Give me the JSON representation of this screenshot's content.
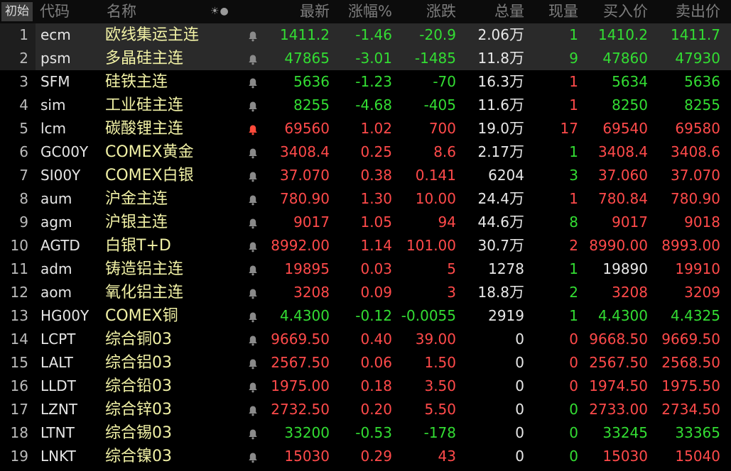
{
  "colors": {
    "up": "#ff4a4a",
    "down": "#33dd33",
    "neutral": "#e8e8e8",
    "name": "#f2f2a6",
    "bell_active": "#ff4a3a",
    "bell_default": "#8a8a8a"
  },
  "header": {
    "corner": "初始",
    "icons": "☀●",
    "columns": {
      "code": "代码",
      "name": "名称",
      "last": "最新",
      "pct": "涨幅%",
      "chg": "涨跌",
      "vol": "总量",
      "cur": "现量",
      "bid": "买入价",
      "ask": "卖出价"
    }
  },
  "rows": [
    {
      "idx": "1",
      "code": "ecm",
      "name": "欧线集运主连",
      "bell": "default",
      "last": "1411.2",
      "pct": "-1.46",
      "chg": "-20.9",
      "vol": "2.06",
      "unit": "万",
      "cur": "1",
      "bid": "1410.2",
      "ask": "1411.7",
      "trend": "down",
      "cur_trend": "down",
      "bid_trend": "down",
      "ask_trend": "down",
      "selected": true
    },
    {
      "idx": "2",
      "code": "psm",
      "name": "多晶硅主连",
      "bell": "default",
      "last": "47865",
      "pct": "-3.01",
      "chg": "-1485",
      "vol": "11.8",
      "unit": "万",
      "cur": "9",
      "bid": "47860",
      "ask": "47930",
      "trend": "down",
      "cur_trend": "down",
      "bid_trend": "down",
      "ask_trend": "down",
      "selected": true
    },
    {
      "idx": "3",
      "code": "SFM",
      "name": "硅铁主连",
      "bell": "default",
      "last": "5636",
      "pct": "-1.23",
      "chg": "-70",
      "vol": "16.3",
      "unit": "万",
      "cur": "1",
      "bid": "5634",
      "ask": "5636",
      "trend": "down",
      "cur_trend": "up",
      "bid_trend": "down",
      "ask_trend": "down"
    },
    {
      "idx": "4",
      "code": "sim",
      "name": "工业硅主连",
      "bell": "default",
      "last": "8255",
      "pct": "-4.68",
      "chg": "-405",
      "vol": "11.6",
      "unit": "万",
      "cur": "1",
      "bid": "8250",
      "ask": "8255",
      "trend": "down",
      "cur_trend": "up",
      "bid_trend": "down",
      "ask_trend": "down"
    },
    {
      "idx": "5",
      "code": "lcm",
      "name": "碳酸锂主连",
      "bell": "active",
      "last": "69560",
      "pct": "1.02",
      "chg": "700",
      "vol": "19.0",
      "unit": "万",
      "cur": "17",
      "bid": "69540",
      "ask": "69580",
      "trend": "up",
      "cur_trend": "up",
      "bid_trend": "up",
      "ask_trend": "up"
    },
    {
      "idx": "6",
      "code": "GC00Y",
      "name": "COMEX黄金",
      "bell": "default",
      "last": "3408.4",
      "pct": "0.25",
      "chg": "8.6",
      "vol": "2.17",
      "unit": "万",
      "cur": "1",
      "bid": "3408.4",
      "ask": "3408.6",
      "trend": "up",
      "cur_trend": "down",
      "bid_trend": "up",
      "ask_trend": "up"
    },
    {
      "idx": "7",
      "code": "SI00Y",
      "name": "COMEX白银",
      "bell": "default",
      "last": "37.070",
      "pct": "0.38",
      "chg": "0.141",
      "vol": "6204",
      "unit": "",
      "cur": "3",
      "bid": "37.060",
      "ask": "37.070",
      "trend": "up",
      "cur_trend": "down",
      "bid_trend": "up",
      "ask_trend": "up"
    },
    {
      "idx": "8",
      "code": "aum",
      "name": "沪金主连",
      "bell": "default",
      "last": "780.90",
      "pct": "1.30",
      "chg": "10.00",
      "vol": "24.4",
      "unit": "万",
      "cur": "1",
      "bid": "780.84",
      "ask": "780.90",
      "trend": "up",
      "cur_trend": "up",
      "bid_trend": "up",
      "ask_trend": "up"
    },
    {
      "idx": "9",
      "code": "agm",
      "name": "沪银主连",
      "bell": "default",
      "last": "9017",
      "pct": "1.05",
      "chg": "94",
      "vol": "44.6",
      "unit": "万",
      "cur": "8",
      "bid": "9017",
      "ask": "9018",
      "trend": "up",
      "cur_trend": "down",
      "bid_trend": "up",
      "ask_trend": "up"
    },
    {
      "idx": "10",
      "code": "AGTD",
      "name": "白银T+D",
      "bell": "default",
      "last": "8992.00",
      "pct": "1.14",
      "chg": "101.00",
      "vol": "30.7",
      "unit": "万",
      "cur": "2",
      "bid": "8990.00",
      "ask": "8993.00",
      "trend": "up",
      "cur_trend": "up",
      "bid_trend": "up",
      "ask_trend": "up"
    },
    {
      "idx": "11",
      "code": "adm",
      "name": "铸造铝主连",
      "bell": "default",
      "last": "19895",
      "pct": "0.03",
      "chg": "5",
      "vol": "1278",
      "unit": "",
      "cur": "1",
      "bid": "19890",
      "ask": "19910",
      "trend": "up",
      "cur_trend": "down",
      "bid_trend": "neutral",
      "ask_trend": "up"
    },
    {
      "idx": "12",
      "code": "aom",
      "name": "氧化铝主连",
      "bell": "default",
      "last": "3208",
      "pct": "0.09",
      "chg": "3",
      "vol": "18.8",
      "unit": "万",
      "cur": "2",
      "bid": "3208",
      "ask": "3209",
      "trend": "up",
      "cur_trend": "down",
      "bid_trend": "up",
      "ask_trend": "up"
    },
    {
      "idx": "13",
      "code": "HG00Y",
      "name": "COMEX铜",
      "bell": "default",
      "last": "4.4300",
      "pct": "-0.12",
      "chg": "-0.0055",
      "vol": "2919",
      "unit": "",
      "cur": "1",
      "bid": "4.4300",
      "ask": "4.4325",
      "trend": "down",
      "cur_trend": "down",
      "bid_trend": "down",
      "ask_trend": "down"
    },
    {
      "idx": "14",
      "code": "LCPT",
      "name": "综合铜03",
      "bell": "default",
      "last": "9669.50",
      "pct": "0.40",
      "chg": "39.00",
      "vol": "0",
      "unit": "",
      "cur": "0",
      "bid": "9668.50",
      "ask": "9669.50",
      "trend": "up",
      "cur_trend": "up",
      "bid_trend": "up",
      "ask_trend": "up"
    },
    {
      "idx": "15",
      "code": "LALT",
      "name": "综合铝03",
      "bell": "default",
      "last": "2567.50",
      "pct": "0.06",
      "chg": "1.50",
      "vol": "0",
      "unit": "",
      "cur": "0",
      "bid": "2567.50",
      "ask": "2568.50",
      "trend": "up",
      "cur_trend": "up",
      "bid_trend": "up",
      "ask_trend": "up"
    },
    {
      "idx": "16",
      "code": "LLDT",
      "name": "综合铅03",
      "bell": "default",
      "last": "1975.00",
      "pct": "0.18",
      "chg": "3.50",
      "vol": "0",
      "unit": "",
      "cur": "0",
      "bid": "1974.50",
      "ask": "1975.50",
      "trend": "up",
      "cur_trend": "up",
      "bid_trend": "up",
      "ask_trend": "up"
    },
    {
      "idx": "17",
      "code": "LZNT",
      "name": "综合锌03",
      "bell": "default",
      "last": "2732.50",
      "pct": "0.20",
      "chg": "5.50",
      "vol": "0",
      "unit": "",
      "cur": "0",
      "bid": "2733.00",
      "ask": "2734.50",
      "trend": "up",
      "cur_trend": "down",
      "bid_trend": "up",
      "ask_trend": "up"
    },
    {
      "idx": "18",
      "code": "LTNT",
      "name": "综合锡03",
      "bell": "default",
      "last": "33200",
      "pct": "-0.53",
      "chg": "-178",
      "vol": "0",
      "unit": "",
      "cur": "0",
      "bid": "33245",
      "ask": "33365",
      "trend": "down",
      "cur_trend": "down",
      "bid_trend": "down",
      "ask_trend": "down"
    },
    {
      "idx": "19",
      "code": "LNKT",
      "name": "综合镍03",
      "bell": "default",
      "last": "15030",
      "pct": "0.29",
      "chg": "43",
      "vol": "0",
      "unit": "",
      "cur": "0",
      "bid": "15030",
      "ask": "15040",
      "trend": "up",
      "cur_trend": "down",
      "bid_trend": "up",
      "ask_trend": "up"
    }
  ]
}
